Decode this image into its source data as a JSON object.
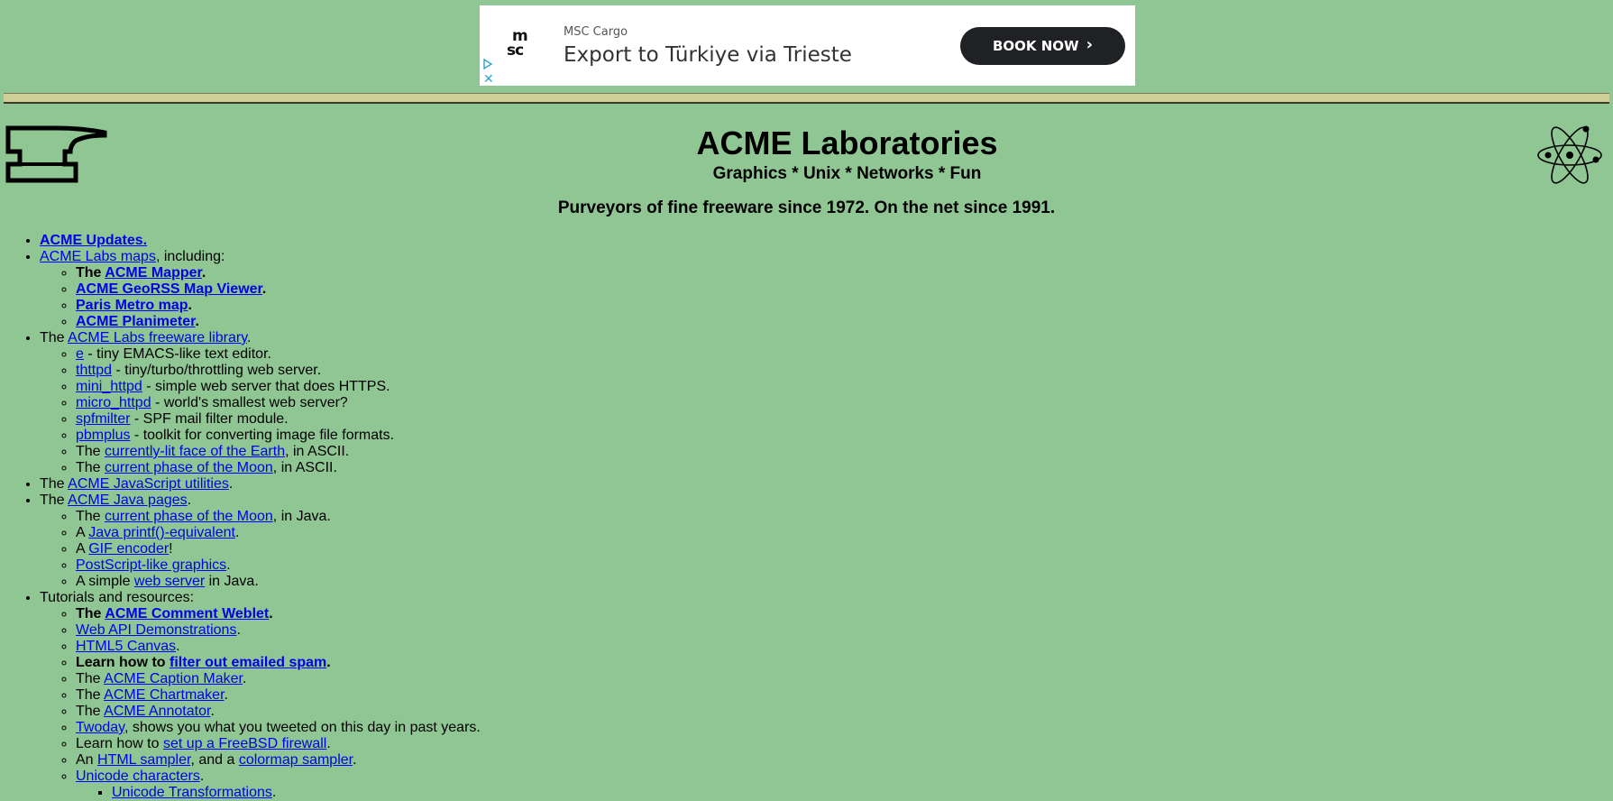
{
  "ad": {
    "sponsor": "MSC Cargo",
    "headline": "Export to Türkiye via Trieste",
    "cta": "BOOK NOW",
    "logo_text_1": "m",
    "logo_text_2": "sc",
    "close": "✕"
  },
  "header": {
    "title": "ACME Laboratories",
    "subtitle": "Graphics * Unix * Networks * Fun",
    "tagline": "Purveyors of fine freeware since 1972. On the net since 1991."
  },
  "list": {
    "updates": "ACME Updates.",
    "maps": {
      "link": "ACME Labs maps",
      "after": ", including:",
      "mapper_pre": "The ",
      "mapper": "ACME Mapper",
      "georss": "ACME GeoRSS Map Viewer",
      "metro": "Paris Metro map",
      "planimeter": "ACME Planimeter"
    },
    "freeware": {
      "pre": "The ",
      "link": "ACME Labs freeware library",
      "items": [
        {
          "link": "e",
          "text": " - tiny EMACS-like text editor."
        },
        {
          "link": "thttpd",
          "text": " - tiny/turbo/throttling web server."
        },
        {
          "link": "mini_httpd",
          "text": " - simple web server that does HTTPS."
        },
        {
          "link": "micro_httpd",
          "text": " - world's smallest web server?"
        },
        {
          "link": "spfmilter",
          "text": " - SPF mail filter module."
        },
        {
          "link": "pbmplus",
          "text": " - toolkit for converting image file formats."
        }
      ],
      "earth_pre": "The ",
      "earth": "currently-lit face of the Earth",
      "earth_post": ", in ASCII.",
      "moon_pre": "The ",
      "moon": "current phase of the Moon",
      "moon_post": ", in ASCII."
    },
    "js": {
      "pre": "The ",
      "link": "ACME JavaScript utilities"
    },
    "java": {
      "pre": "The ",
      "link": "ACME Java pages",
      "moon_pre": "The ",
      "moon": "current phase of the Moon",
      "moon_post": ", in Java.",
      "printf_pre": "A ",
      "printf": "Java printf()-equivalent",
      "gif_pre": "A ",
      "gif": "GIF encoder",
      "gif_post": "!",
      "postscript": "PostScript-like graphics",
      "web_pre": "A simple ",
      "web": "web server",
      "web_post": " in Java."
    },
    "tutorials": {
      "label": "Tutorials and resources:",
      "weblet_pre": "The ",
      "weblet": "ACME Comment Weblet",
      "webapi": "Web API Demonstrations",
      "canvas": "HTML5 Canvas",
      "spam_pre": "Learn how to ",
      "spam": "filter out emailed spam",
      "caption_pre": "The ",
      "caption": "ACME Caption Maker",
      "chart_pre": "The ",
      "chart": "ACME Chartmaker",
      "annot_pre": "The ",
      "annot": "ACME Annotator",
      "twoday": "Twoday",
      "twoday_post": ", shows you what you tweeted on this day in past years.",
      "freebsd_pre": "Learn how to ",
      "freebsd": "set up a FreeBSD firewall",
      "html_pre": "An ",
      "html": "HTML sampler",
      "html_mid": ", and a ",
      "colormap": "colormap sampler",
      "unicode": "Unicode characters",
      "unicode_trans": "Unicode Transformations"
    }
  }
}
